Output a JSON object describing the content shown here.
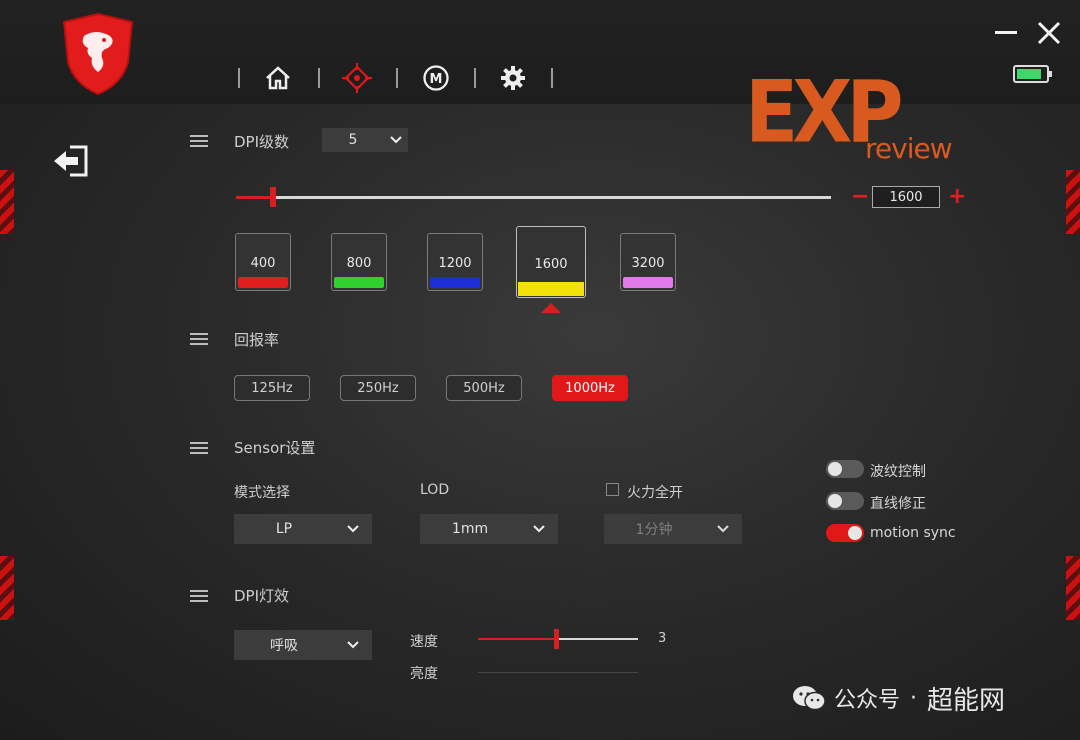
{
  "nav": {
    "tabs": [
      {
        "name": "home",
        "icon": "home-icon"
      },
      {
        "name": "target",
        "icon": "crosshair-icon",
        "active": true
      },
      {
        "name": "macro",
        "icon": "macro-m-icon",
        "label": "M"
      },
      {
        "name": "settings",
        "icon": "gear-icon"
      }
    ]
  },
  "brand": {
    "big": "EXP",
    "small": "review"
  },
  "dpi": {
    "section_title": "DPI级数",
    "levels_value": "5",
    "current_value": "1600",
    "minus": "−",
    "plus": "+",
    "slider_fraction": 0.06,
    "levels": [
      {
        "value": "400",
        "color": "#e01e1e"
      },
      {
        "value": "800",
        "color": "#2ed12e"
      },
      {
        "value": "1200",
        "color": "#1e2ed6"
      },
      {
        "value": "1600",
        "color": "#f2e20a",
        "active": true
      },
      {
        "value": "3200",
        "color": "#e07ae6"
      }
    ]
  },
  "report_rate": {
    "section_title": "回报率",
    "options": [
      {
        "label": "125Hz"
      },
      {
        "label": "250Hz"
      },
      {
        "label": "500Hz"
      },
      {
        "label": "1000Hz",
        "active": true
      }
    ]
  },
  "sensor": {
    "section_title": "Sensor设置",
    "mode_label": "模式选择",
    "mode_value": "LP",
    "lod_label": "LOD",
    "lod_value": "1mm",
    "fire_label": "火力全开",
    "fire_checked": false,
    "fire_value": "1分钟",
    "toggles": [
      {
        "label": "波纹控制",
        "on": false
      },
      {
        "label": "直线修正",
        "on": false
      },
      {
        "label": "motion sync",
        "on": true
      }
    ]
  },
  "light": {
    "section_title": "DPI灯效",
    "effect_value": "呼吸",
    "speed_label": "速度",
    "speed_value": "3",
    "brightness_label": "亮度"
  },
  "watermark": {
    "t1": "公众号",
    "dot": "·",
    "t2": "超能网"
  },
  "colors": {
    "accent": "#e01818",
    "brand_orange": "#d85a1e",
    "battery": "#3ad96a"
  }
}
